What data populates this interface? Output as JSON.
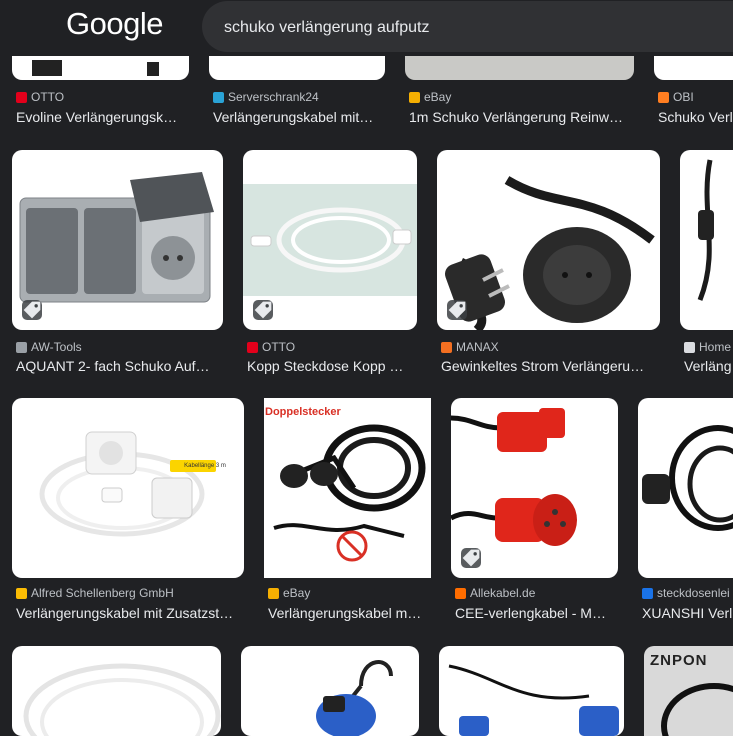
{
  "header": {
    "logo": "Google",
    "query": "schuko verlängerung aufputz"
  },
  "row1": [
    {
      "source": "OTTO",
      "title": "Evoline Verlängerungsk…",
      "fav": "#e3001b"
    },
    {
      "source": "Serverschrank24",
      "title": "Verlängerungskabel mit…",
      "fav": "#2aa3d6"
    },
    {
      "source": "eBay",
      "title": "1m Schuko Verlängerung Reinw…",
      "fav": "#f5af02"
    },
    {
      "source": "OBI",
      "title": "Schuko Verl",
      "fav": "#ff7e21"
    }
  ],
  "row2": [
    {
      "source": "AW-Tools",
      "title": "AQUANT 2- fach Schuko Auf…",
      "fav": "#9aa0a6"
    },
    {
      "source": "OTTO",
      "title": "Kopp Steckdose Kopp …",
      "fav": "#e3001b"
    },
    {
      "source": "MANAX",
      "title": "Gewinkeltes Strom Verlängeru…",
      "fav": "#f36f21"
    },
    {
      "source": "Home",
      "title": "Verläng",
      "fav": "#dadce0"
    }
  ],
  "row3": [
    {
      "source": "Alfred Schellenberg GmbH",
      "title": "Verlängerungskabel mit Zusatzst…",
      "fav": "#fbbc04"
    },
    {
      "source": "eBay",
      "title": "Verlängerungskabel m…",
      "fav": "#f5af02"
    },
    {
      "source": "Allekabel.de",
      "title": "CEE-verlengkabel - M…",
      "fav": "#ff6d00"
    },
    {
      "source": "steckdosenlei",
      "title": "XUANSHI Verl",
      "fav": "#1a73e8"
    }
  ],
  "thumb_text": {
    "doppel": "Doppelstecker",
    "kabel": "Kabellänge 3 m",
    "znpon": "ZNPON"
  }
}
